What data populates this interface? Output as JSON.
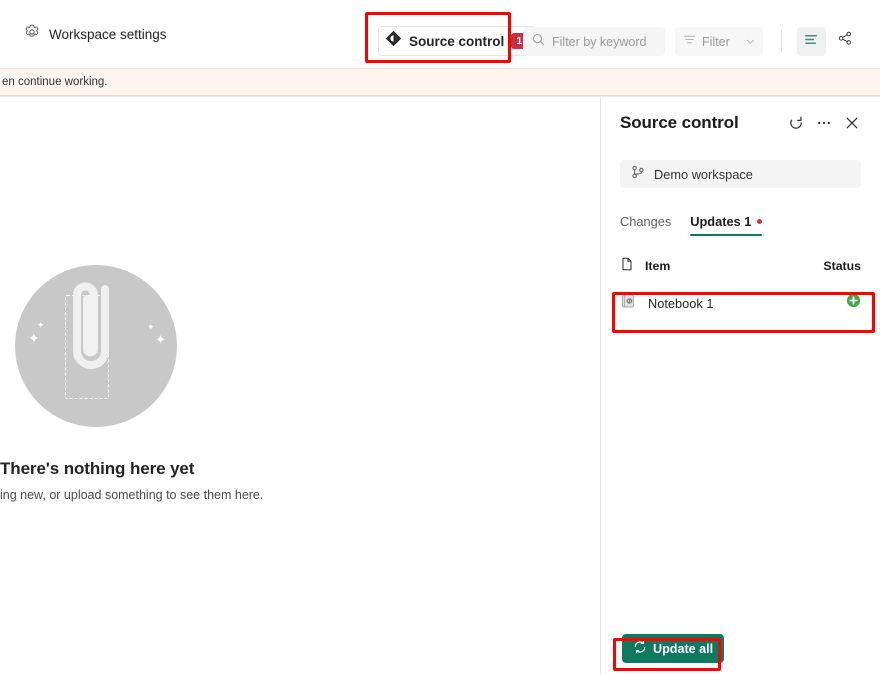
{
  "toolbar": {
    "workspace_settings_label": "Workspace settings",
    "workspace_settings_icon": "gear-icon",
    "source_control_label": "Source control",
    "source_control_icon": "source-control-diamond-icon",
    "source_control_badge": "1",
    "search_placeholder": "Filter by keyword",
    "search_icon": "search-icon",
    "filter_label": "Filter",
    "filter_icon": "filter-lines-icon",
    "filter_chevron_icon": "chevron-down-icon",
    "view_icon": "list-view-icon",
    "share_icon": "share-graph-icon"
  },
  "banner": {
    "text": "en continue working."
  },
  "empty_state": {
    "illustration_icon": "paperclip-attachment-icon",
    "title": "There's nothing here yet",
    "subtitle": "ing new, or upload something to see them here."
  },
  "panel": {
    "title": "Source control",
    "refresh_icon": "refresh-icon",
    "more_icon": "more-options-icon",
    "close_icon": "close-icon",
    "workspace": {
      "label": "Demo workspace",
      "icon": "branch-icon"
    },
    "tabs": [
      {
        "label": "Changes",
        "active": false,
        "has_dot": false
      },
      {
        "label": "Updates 1",
        "active": true,
        "has_dot": true
      }
    ],
    "columns": {
      "item_icon": "file-icon",
      "item_label": "Item",
      "status_label": "Status"
    },
    "rows": [
      {
        "name": "Notebook 1",
        "icon": "notebook-code-icon",
        "status_icon": "added-green-plus-icon"
      }
    ],
    "update_all_label": "Update all",
    "update_all_icon": "sync-icon"
  },
  "annotations": {
    "source_control_highlight": "red-box",
    "notebook_row_highlight": "red-box",
    "update_all_highlight": "red-box"
  },
  "colors": {
    "accent_green": "#0f7a5f",
    "tab_underline": "#0f7a63",
    "badge_red": "#c4314b",
    "dot_red": "#d13438",
    "status_green": "#3fa847",
    "annotation_red": "#ff0000",
    "banner_bg": "#fdf3ef"
  }
}
